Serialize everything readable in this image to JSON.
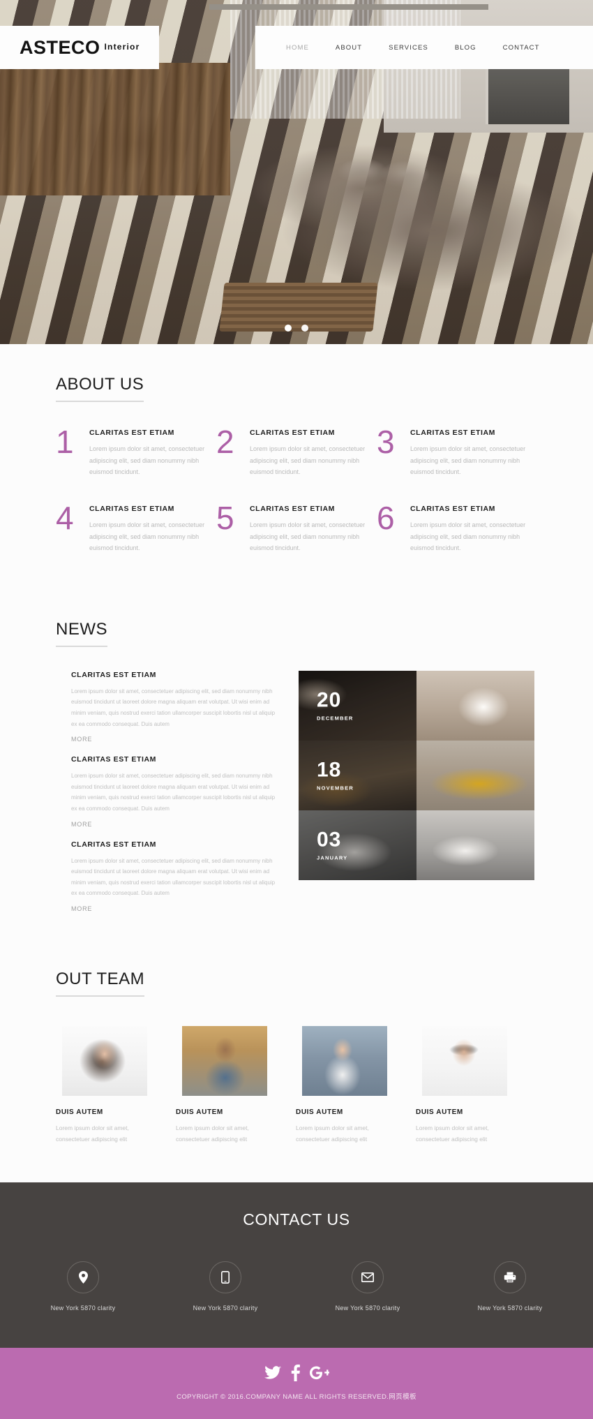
{
  "brand": {
    "name": "ASTECO",
    "suffix": "Interior"
  },
  "nav": {
    "items": [
      {
        "label": "HOME",
        "active": true
      },
      {
        "label": "ABOUT",
        "active": false
      },
      {
        "label": "SERVICES",
        "active": false
      },
      {
        "label": "BLOG",
        "active": false
      },
      {
        "label": "CONTACT",
        "active": false
      }
    ]
  },
  "slider": {
    "dots": 2,
    "active_index": 0
  },
  "about": {
    "title": "ABOUT US",
    "items": [
      {
        "num": "1",
        "heading": "CLARITAS EST ETIAM",
        "text": "Lorem ipsum dolor sit amet, consectetuer adipiscing elit, sed diam nonummy nibh euismod tincidunt."
      },
      {
        "num": "2",
        "heading": "CLARITAS EST ETIAM",
        "text": "Lorem ipsum dolor sit amet, consectetuer adipiscing elit, sed diam nonummy nibh euismod tincidunt."
      },
      {
        "num": "3",
        "heading": "CLARITAS EST ETIAM",
        "text": "Lorem ipsum dolor sit amet, consectetuer adipiscing elit, sed diam nonummy nibh euismod tincidunt."
      },
      {
        "num": "4",
        "heading": "CLARITAS EST ETIAM",
        "text": "Lorem ipsum dolor sit amet, consectetuer adipiscing elit, sed diam nonummy nibh euismod tincidunt."
      },
      {
        "num": "5",
        "heading": "CLARITAS EST ETIAM",
        "text": "Lorem ipsum dolor sit amet, consectetuer adipiscing elit, sed diam nonummy nibh euismod tincidunt."
      },
      {
        "num": "6",
        "heading": "CLARITAS EST ETIAM",
        "text": "Lorem ipsum dolor sit amet, consectetuer adipiscing elit, sed diam nonummy nibh euismod tincidunt."
      }
    ]
  },
  "news": {
    "title": "NEWS",
    "posts": [
      {
        "heading": "CLARITAS EST ETIAM",
        "text": "Lorem ipsum dolor sit amet, consectetuer adipiscing elit, sed diam nonummy nibh euismod tincidunt ut laoreet dolore magna aliquam erat volutpat. Ut wisi enim ad minim veniam, quis nostrud exerci tation ullamcorper suscipit lobortis nisl ut aliquip ex ea commodo consequat. Duis autem",
        "more": "MORE"
      },
      {
        "heading": "CLARITAS EST ETIAM",
        "text": "Lorem ipsum dolor sit amet, consectetuer adipiscing elit, sed diam nonummy nibh euismod tincidunt ut laoreet dolore magna aliquam erat volutpat. Ut wisi enim ad minim veniam, quis nostrud exerci tation ullamcorper suscipit lobortis nisl ut aliquip ex ea commodo consequat. Duis autem",
        "more": "MORE"
      },
      {
        "heading": "CLARITAS EST ETIAM",
        "text": "Lorem ipsum dolor sit amet, consectetuer adipiscing elit, sed diam nonummy nibh euismod tincidunt ut laoreet dolore magna aliquam erat volutpat. Ut wisi enim ad minim veniam, quis nostrud exerci tation ullamcorper suscipit lobortis nisl ut aliquip ex ea commodo consequat. Duis autem",
        "more": "MORE"
      }
    ],
    "dates": [
      {
        "day": "20",
        "month": "DECEMBER"
      },
      {
        "day": "18",
        "month": "NOVEMBER"
      },
      {
        "day": "03",
        "month": "JANUARY"
      }
    ]
  },
  "team": {
    "title": "OUT TEAM",
    "members": [
      {
        "name": "DUIS AUTEM",
        "text": "Lorem ipsum dolor sit amet, consectetuer adipiscing elit"
      },
      {
        "name": "DUIS AUTEM",
        "text": "Lorem ipsum dolor sit amet, consectetuer adipiscing elit"
      },
      {
        "name": "DUIS AUTEM",
        "text": "Lorem ipsum dolor sit amet, consectetuer adipiscing elit"
      },
      {
        "name": "DUIS AUTEM",
        "text": "Lorem ipsum dolor sit amet, consectetuer adipiscing elit"
      }
    ]
  },
  "contact": {
    "title": "CONTACT US",
    "items": [
      {
        "icon": "location-pin-icon",
        "label": "New York 5870 clarity"
      },
      {
        "icon": "mobile-phone-icon",
        "label": "New York 5870 clarity"
      },
      {
        "icon": "envelope-icon",
        "label": "New York 5870 clarity"
      },
      {
        "icon": "printer-icon",
        "label": "New York 5870 clarity"
      }
    ]
  },
  "footer": {
    "social": [
      {
        "icon": "twitter-icon",
        "label": "Twitter"
      },
      {
        "icon": "facebook-icon",
        "label": "Facebook"
      },
      {
        "icon": "google-plus-icon",
        "label": "Google Plus"
      }
    ],
    "copyright": "COPYRIGHT © 2016.COMPANY NAME ALL RIGHTS RESERVED.网页模板"
  },
  "colors": {
    "accent_purple": "#ac5fa6",
    "footer_purple": "#bb6bb0",
    "contact_dark": "#474341",
    "text_dark": "#1c1c1c",
    "text_muted": "#bdbdbd"
  }
}
